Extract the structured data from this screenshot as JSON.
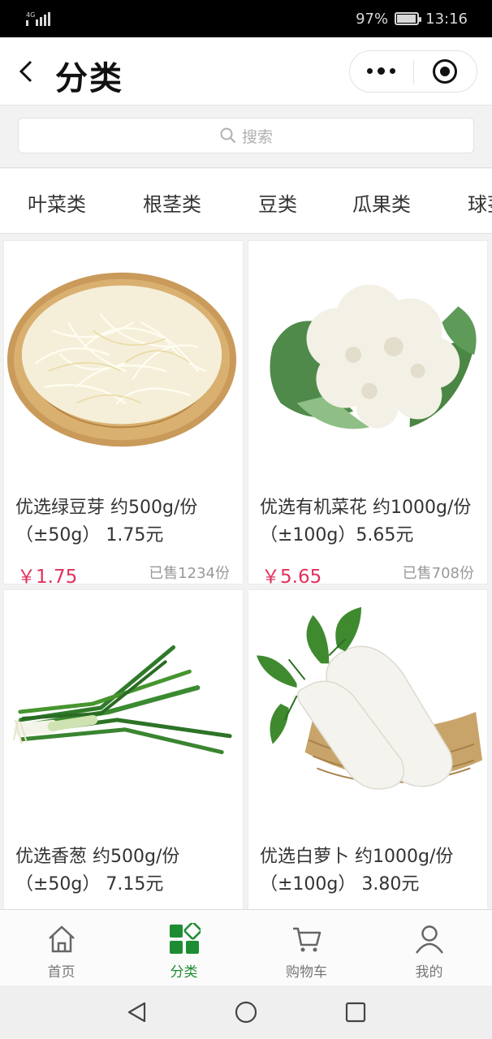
{
  "status_bar": {
    "network": "4G",
    "battery": "97%",
    "battery_level": 0.97,
    "time": "13:16"
  },
  "header": {
    "title": "分类"
  },
  "search": {
    "placeholder": "搜索"
  },
  "category_tabs": [
    {
      "label": "叶菜类"
    },
    {
      "label": "根茎类"
    },
    {
      "label": "豆类"
    },
    {
      "label": "瓜果类"
    },
    {
      "label": "球茎类"
    }
  ],
  "products": [
    {
      "name": "优选绿豆芽 约500g/份（±50g） 1.75元",
      "price": "￥1.75",
      "sold": "已售1234份",
      "image": "bean-sprouts-image"
    },
    {
      "name": "优选有机菜花 约1000g/份（±100g）5.65元",
      "price": "￥5.65",
      "sold": "已售708份",
      "image": "cauliflower-image"
    },
    {
      "name": "优选香葱 约500g/份（±50g） 7.15元",
      "price": "",
      "sold": "",
      "image": "scallion-image"
    },
    {
      "name": "优选白萝卜 约1000g/份（±100g） 3.80元",
      "price": "",
      "sold": "",
      "image": "white-radish-image"
    }
  ],
  "bottom_nav": [
    {
      "label": "首页",
      "icon": "home-icon",
      "active": false
    },
    {
      "label": "分类",
      "icon": "category-icon",
      "active": true
    },
    {
      "label": "购物车",
      "icon": "cart-icon",
      "active": false
    },
    {
      "label": "我的",
      "icon": "user-icon",
      "active": false
    }
  ],
  "colors": {
    "accent_green": "#1e8c33",
    "price_red": "#e0325c"
  }
}
